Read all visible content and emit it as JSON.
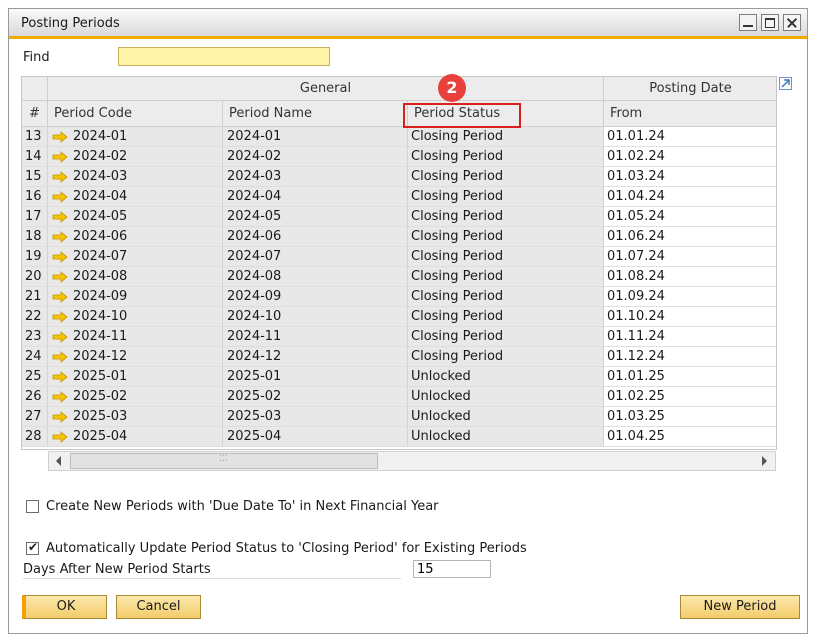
{
  "window": {
    "title": "Posting Periods"
  },
  "find": {
    "label": "Find",
    "value": ""
  },
  "grid": {
    "group_headers": [
      "General",
      "Posting Date"
    ],
    "columns": [
      "#",
      "Period Code",
      "Period Name",
      "Period Status",
      "From"
    ],
    "rows": [
      {
        "num": "13",
        "code": "2024-01",
        "name": "2024-01",
        "status": "Closing Period",
        "from": "01.01.24"
      },
      {
        "num": "14",
        "code": "2024-02",
        "name": "2024-02",
        "status": "Closing Period",
        "from": "01.02.24"
      },
      {
        "num": "15",
        "code": "2024-03",
        "name": "2024-03",
        "status": "Closing Period",
        "from": "01.03.24"
      },
      {
        "num": "16",
        "code": "2024-04",
        "name": "2024-04",
        "status": "Closing Period",
        "from": "01.04.24"
      },
      {
        "num": "17",
        "code": "2024-05",
        "name": "2024-05",
        "status": "Closing Period",
        "from": "01.05.24"
      },
      {
        "num": "18",
        "code": "2024-06",
        "name": "2024-06",
        "status": "Closing Period",
        "from": "01.06.24"
      },
      {
        "num": "19",
        "code": "2024-07",
        "name": "2024-07",
        "status": "Closing Period",
        "from": "01.07.24"
      },
      {
        "num": "20",
        "code": "2024-08",
        "name": "2024-08",
        "status": "Closing Period",
        "from": "01.08.24"
      },
      {
        "num": "21",
        "code": "2024-09",
        "name": "2024-09",
        "status": "Closing Period",
        "from": "01.09.24"
      },
      {
        "num": "22",
        "code": "2024-10",
        "name": "2024-10",
        "status": "Closing Period",
        "from": "01.10.24"
      },
      {
        "num": "23",
        "code": "2024-11",
        "name": "2024-11",
        "status": "Closing Period",
        "from": "01.11.24"
      },
      {
        "num": "24",
        "code": "2024-12",
        "name": "2024-12",
        "status": "Closing Period",
        "from": "01.12.24"
      },
      {
        "num": "25",
        "code": "2025-01",
        "name": "2025-01",
        "status": "Unlocked",
        "from": "01.01.25"
      },
      {
        "num": "26",
        "code": "2025-02",
        "name": "2025-02",
        "status": "Unlocked",
        "from": "01.02.25"
      },
      {
        "num": "27",
        "code": "2025-03",
        "name": "2025-03",
        "status": "Unlocked",
        "from": "01.03.25"
      },
      {
        "num": "28",
        "code": "2025-04",
        "name": "2025-04",
        "status": "Unlocked",
        "from": "01.04.25"
      }
    ]
  },
  "annotation": {
    "step_number": "2"
  },
  "options": {
    "create_new_periods": {
      "label": "Create New Periods with 'Due Date To' in Next Financial Year",
      "checked": false
    },
    "auto_update": {
      "label": "Automatically Update Period Status to 'Closing Period' for Existing Periods",
      "checked": true
    },
    "days_after_label": "Days After New Period Starts",
    "days_after_value": "15"
  },
  "buttons": {
    "ok": "OK",
    "cancel": "Cancel",
    "new_period": "New Period"
  },
  "colors": {
    "accent": "#f0ab00",
    "button": "#f5d67f",
    "highlight": "#d8201d",
    "badge": "#e8413b",
    "find_bg": "#fff3a8"
  },
  "icons": {
    "row_link": "link-arrow-icon",
    "expand": "expand-icon",
    "check": "checkmark-icon"
  }
}
